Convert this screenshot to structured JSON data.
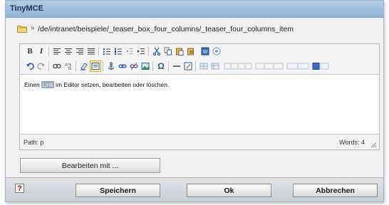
{
  "window": {
    "title": "TinyMCE"
  },
  "location": {
    "arrow": "»",
    "path": "/de/intranet/beispiele/_teaser_box_four_columns/_teaser_four_columns_item"
  },
  "toolbar1": {
    "bold": "B",
    "italic": "I"
  },
  "toolbar2": {
    "special_char": "Ω"
  },
  "editor": {
    "text_before": "Einen ",
    "selected_text": "Link",
    "text_after": " im Editor setzen, bearbeiten oder löschen."
  },
  "status": {
    "path": "Path: p",
    "words": "Words: 4"
  },
  "edit_with_button": "Bearbeiten mit ...",
  "footer": {
    "help_label": "?",
    "save_label": "Speichern",
    "ok_label": "Ok",
    "cancel_label": "Abbrechen"
  },
  "colors": {
    "title_bar": "#a4c1e0",
    "selection": "#9aa7b6",
    "help_icon": "#d00000"
  },
  "icons": [
    "folder-icon",
    "bold-icon",
    "italic-icon",
    "align-left-icon",
    "align-center-icon",
    "align-right-icon",
    "align-justify-icon",
    "bullet-list-icon",
    "numbered-list-icon",
    "outdent-icon",
    "indent-icon",
    "cut-icon",
    "copy-icon",
    "paste-icon",
    "paste-text-icon",
    "paste-word-icon",
    "help-circle-icon",
    "undo-icon",
    "redo-icon",
    "find-icon",
    "replace-icon",
    "cleanup-icon",
    "code-icon",
    "anchor-icon",
    "link-icon",
    "unlink-icon",
    "image-icon",
    "special-char-icon",
    "horizontal-rule-icon",
    "edit-icon",
    "table-icon",
    "resize-grip-icon"
  ]
}
